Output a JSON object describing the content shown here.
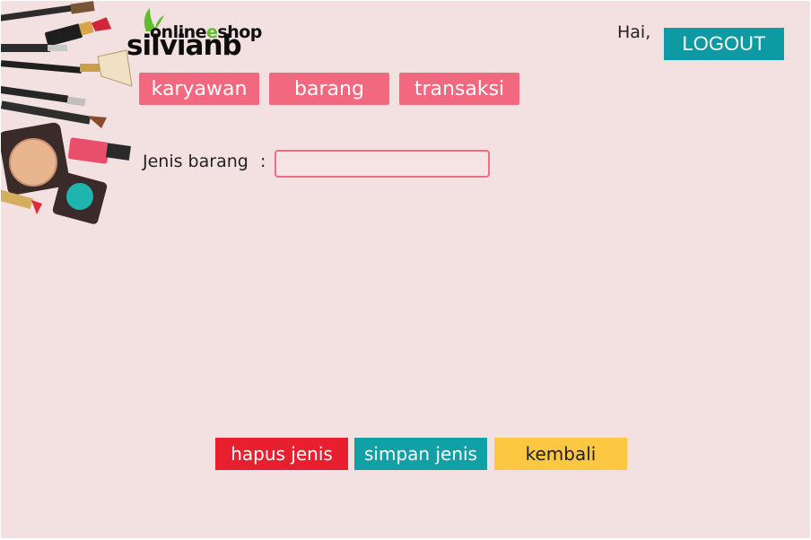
{
  "header": {
    "logo_small": "online",
    "logo_o": "e",
    "logo_shop": "shop",
    "logo_big": "silvianb",
    "greeting": "Hai,",
    "logout_label": "LOGOUT"
  },
  "nav": {
    "items": [
      {
        "label": "karyawan"
      },
      {
        "label": "barang"
      },
      {
        "label": "transaksi"
      }
    ]
  },
  "form": {
    "jenis_label": "Jenis barang",
    "colon": ":",
    "jenis_value": ""
  },
  "actions": {
    "delete_label": "hapus jenis",
    "save_label": "simpan jenis",
    "back_label": "kembali"
  },
  "colors": {
    "background": "#f3e0e1",
    "nav": "#f2687f",
    "teal": "#0d9aa2",
    "red": "#e81f2e",
    "yellow": "#fcc842"
  }
}
